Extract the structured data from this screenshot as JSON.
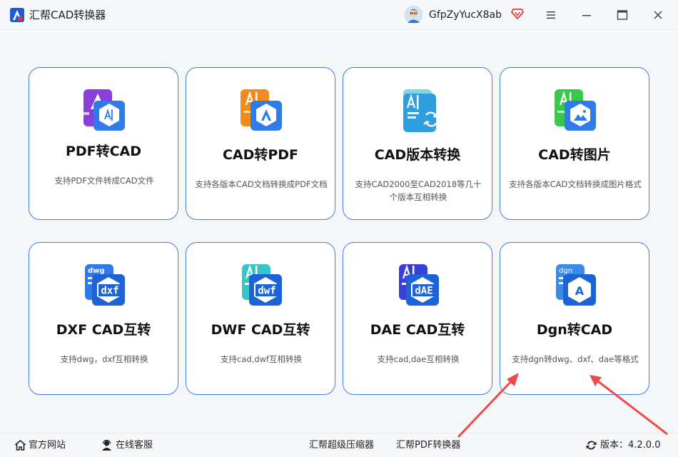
{
  "app": {
    "title": "汇帮CAD转换器",
    "username": "GfpZyYucX8ab",
    "accent_color": "#3f7ee8"
  },
  "cards": [
    {
      "title": "PDF转CAD",
      "desc": "支持PDF文件转成CAD文件",
      "icon": "pdf-to-cad-icon"
    },
    {
      "title": "CAD转PDF",
      "desc": "支持各版本CAD文档转换成PDF文档",
      "icon": "cad-to-pdf-icon"
    },
    {
      "title": "CAD版本转换",
      "desc": "支持CAD2000至CAD2018等几十个版本互相转换",
      "icon": "cad-version-icon"
    },
    {
      "title": "CAD转图片",
      "desc": "支持各版本CAD文档转换成图片格式",
      "icon": "cad-to-image-icon"
    },
    {
      "title": "DXF CAD互转",
      "desc": "支持dwg，dxf互相转换",
      "icon": "dxf-icon",
      "badge": "dxf",
      "sub": "dwg"
    },
    {
      "title": "DWF CAD互转",
      "desc": "支持cad,dwf互相转换",
      "icon": "dwf-icon",
      "badge": "dwf"
    },
    {
      "title": "DAE CAD互转",
      "desc": "支持cad,dae互相转换",
      "icon": "dae-icon",
      "badge": "dAE"
    },
    {
      "title": "Dgn转CAD",
      "desc": "支持dgn转dwg、dxf、dae等格式",
      "icon": "dgn-icon",
      "badge": "A",
      "sub": "dgn"
    }
  ],
  "footer": {
    "website": "官方网站",
    "support": "在线客服",
    "compressor": "汇帮超级压缩器",
    "pdf_converter": "汇帮PDF转换器",
    "version": "版本：4.2.0.0"
  }
}
